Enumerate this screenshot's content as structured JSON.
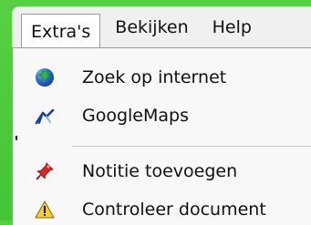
{
  "menubar": {
    "items": [
      {
        "label": "Extra's",
        "active": true
      },
      {
        "label": "Bekijken",
        "active": false
      },
      {
        "label": "Help",
        "active": false
      }
    ]
  },
  "dropdown": {
    "items": [
      {
        "label": "Zoek op internet",
        "icon": "globe-download-icon",
        "has_submenu": true
      },
      {
        "label": "GoogleMaps",
        "icon": "maps-arrow-icon",
        "has_submenu": false
      },
      {
        "label": "Notitie toevoegen",
        "icon": "pushpin-icon",
        "has_submenu": false
      },
      {
        "label": "Controleer document",
        "icon": "warning-icon",
        "has_submenu": false
      }
    ]
  },
  "colors": {
    "background_green": "#54cf3f",
    "menu_bg": "#f0f0f0",
    "dropdown_bg": "#f8f8f8",
    "text": "#111111",
    "border": "#9a9a9a",
    "icon_blue": "#2e5fb3",
    "icon_green": "#2fb34a",
    "pin_red": "#d72828",
    "warning_yellow": "#f3d12b"
  }
}
